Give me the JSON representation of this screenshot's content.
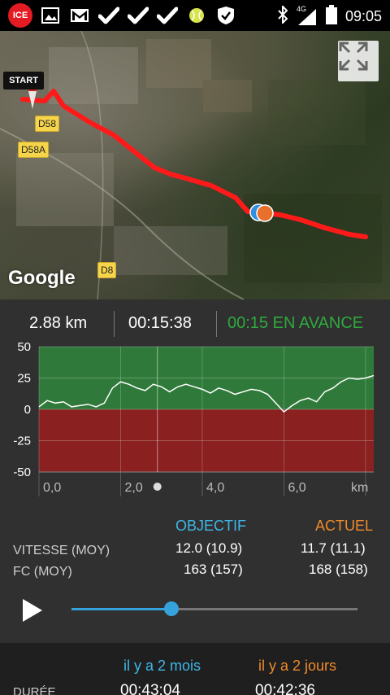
{
  "statusbar": {
    "ice_label": "ICE",
    "network": "4G",
    "time": "09:05",
    "icons": [
      "ice-icon",
      "image-icon",
      "gmail-icon",
      "check-icon",
      "check-icon",
      "check-icon",
      "tennis-ball-icon",
      "shield-icon",
      "bluetooth-icon",
      "signal-icon",
      "battery-icon"
    ]
  },
  "map": {
    "start_label": "START",
    "roads": [
      "D58",
      "D58A",
      "D8"
    ],
    "google_logo": "Google",
    "route_color": "#ff1a1a",
    "marker_colors": [
      "#2f8fe0",
      "#e8702a"
    ]
  },
  "stats": {
    "distance": "2.88 km",
    "elapsed": "00:15:38",
    "pace_status": "00:15 EN AVANCE",
    "pace_color": "#2eaa3e"
  },
  "chart_data": {
    "type": "area",
    "ylim": [
      -50,
      50
    ],
    "y_ticks": [
      "50",
      "25",
      "0",
      "-25",
      "-50"
    ],
    "x_ticks": [
      "0,0",
      "2,0",
      "4,0",
      "6,0"
    ],
    "x_unit": "km",
    "xlim": [
      0,
      8.2
    ],
    "cursor_x": 2.9,
    "positive_color": "#2f7a3a",
    "negative_color": "#8a2020",
    "series": [
      {
        "x": [
          0,
          0.2,
          0.4,
          0.6,
          0.8,
          1.0,
          1.2,
          1.4,
          1.6,
          1.8,
          2.0,
          2.2,
          2.4,
          2.6,
          2.8,
          3.0,
          3.2,
          3.4,
          3.6,
          3.8,
          4.0,
          4.2,
          4.4,
          4.6,
          4.8,
          5.0,
          5.2,
          5.4,
          5.6,
          5.8,
          6.0,
          6.2,
          6.4,
          6.6,
          6.8,
          7.0,
          7.2,
          7.4,
          7.6,
          7.8,
          8.0,
          8.2
        ],
        "y": [
          2,
          7,
          5,
          6,
          2,
          3,
          4,
          2,
          5,
          17,
          22,
          20,
          17,
          15,
          20,
          18,
          14,
          18,
          20,
          18,
          16,
          13,
          17,
          15,
          12,
          14,
          16,
          15,
          12,
          5,
          -2,
          3,
          7,
          9,
          6,
          14,
          17,
          22,
          25,
          24,
          25,
          27
        ]
      }
    ]
  },
  "comparison": {
    "col_target": "OBJECTIF",
    "col_actual": "ACTUEL",
    "target_color": "#3fb7e8",
    "actual_color": "#f08a2a",
    "rows": [
      {
        "label": "VITESSE (MOY)",
        "target": "12.0 (10.9)",
        "actual": "11.7 (11.1)"
      },
      {
        "label": "FC (MOY)",
        "target": "163 (157)",
        "actual": "168 (158)"
      }
    ]
  },
  "player": {
    "progress": 0.35
  },
  "history": {
    "col_1": "il y a 2 mois",
    "col_2": "il y a 2 jours",
    "row_label": "DURÉE",
    "val_1": "00:43:04",
    "val_2": "00:42:36"
  }
}
